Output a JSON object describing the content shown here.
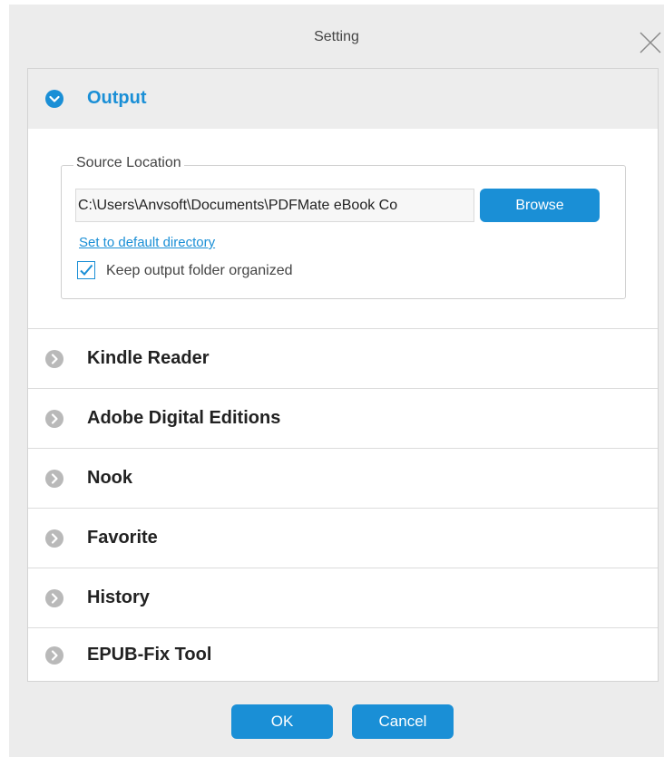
{
  "dialog": {
    "title": "Setting"
  },
  "output": {
    "label": "Output",
    "source_location_legend": "Source Location",
    "path_value": "C:\\Users\\Anvsoft\\Documents\\PDFMate eBook Co",
    "browse_label": "Browse",
    "default_link": "Set to default directory",
    "keep_organized_label": "Keep output folder organized",
    "keep_organized_checked": true
  },
  "sections": [
    {
      "label": "Kindle Reader"
    },
    {
      "label": "Adobe Digital Editions"
    },
    {
      "label": "Nook"
    },
    {
      "label": "Favorite"
    },
    {
      "label": "History"
    },
    {
      "label": "EPUB-Fix Tool"
    }
  ],
  "footer": {
    "ok_label": "OK",
    "cancel_label": "Cancel"
  },
  "colors": {
    "accent": "#1a8fd6",
    "collapsed_icon": "#b9b9b9",
    "dialog_bg": "#ececec"
  },
  "icons": {
    "expanded": "chevron-down-circle-icon",
    "collapsed": "chevron-right-circle-icon",
    "close": "close-icon",
    "check": "check-icon"
  }
}
